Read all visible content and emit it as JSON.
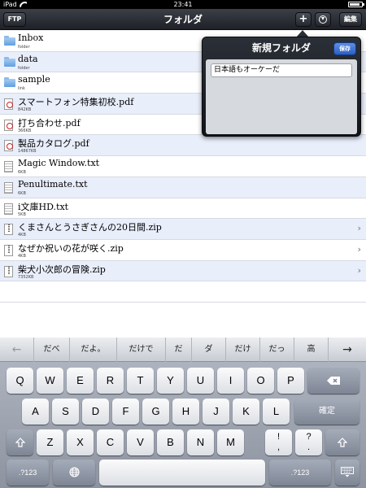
{
  "status": {
    "device": "iPad",
    "time": "23:41",
    "battery_level": 0.85
  },
  "nav": {
    "left_button": "FTP",
    "title": "フォルダ",
    "add_button": "+",
    "edit_button": "編集"
  },
  "files": [
    {
      "name": "Inbox",
      "sub": "folder",
      "type": "folder"
    },
    {
      "name": "data",
      "sub": "folder",
      "type": "folder"
    },
    {
      "name": "sample",
      "sub": "link",
      "type": "folder"
    },
    {
      "name": "スマートフォン特集初校.pdf",
      "sub": "842KB",
      "type": "pdf"
    },
    {
      "name": "打ち合わせ.pdf",
      "sub": "366KB",
      "type": "pdf"
    },
    {
      "name": "製品カタログ.pdf",
      "sub": "14867KB",
      "type": "pdf"
    },
    {
      "name": "Magic Window.txt",
      "sub": "6KB",
      "type": "txt"
    },
    {
      "name": "Penultimate.txt",
      "sub": "6KB",
      "type": "txt"
    },
    {
      "name": "i文庫HD.txt",
      "sub": "5KB",
      "type": "txt"
    },
    {
      "name": "くまさんとうさぎさんの20日間.zip",
      "sub": "4KB",
      "type": "zip",
      "chevron": "›"
    },
    {
      "name": "なぜか祝いの花が咲く.zip",
      "sub": "4KB",
      "type": "zip",
      "chevron": "›"
    },
    {
      "name": "柴犬小次郎の冒険.zip",
      "sub": "7352KB",
      "type": "zip",
      "chevron": "›"
    }
  ],
  "popover": {
    "title": "新規フォルダ",
    "save_button": "保存",
    "input_value": "日本語もオーケーだ"
  },
  "keyboard": {
    "candidates": [
      "←",
      "だべ",
      "だよ。",
      "だけで",
      "だ",
      "ダ",
      "だけ",
      "だっ",
      "高",
      "→"
    ],
    "row1": [
      "Q",
      "W",
      "E",
      "R",
      "T",
      "Y",
      "U",
      "I",
      "O",
      "P"
    ],
    "row2": [
      "A",
      "S",
      "D",
      "F",
      "G",
      "H",
      "J",
      "K",
      "L"
    ],
    "return_key": "確定",
    "row3": [
      "Z",
      "X",
      "C",
      "V",
      "B",
      "N",
      "M"
    ],
    "row3_punct": [
      [
        "!",
        ","
      ],
      [
        "?",
        "."
      ]
    ],
    "numbers_key": ".?123"
  }
}
